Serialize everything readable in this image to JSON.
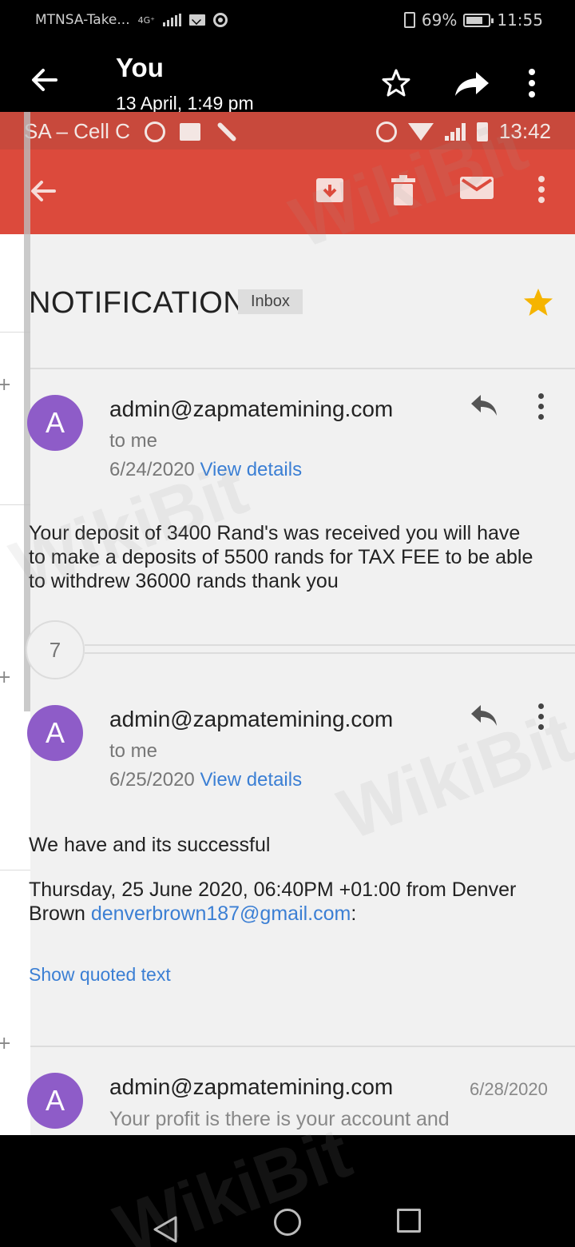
{
  "os_status": {
    "carrier": "MTNSA-Take...",
    "network": "4G⁺",
    "battery": "69%",
    "time": "11:55"
  },
  "viewer": {
    "title": "You",
    "subtitle": "13 April, 1:49 pm"
  },
  "inner_status": {
    "carrier": "SA – Cell C",
    "time": "13:42"
  },
  "email": {
    "subject": "NOTIFICATION",
    "label": "Inbox",
    "messages": [
      {
        "avatar": "A",
        "sender": "admin@zapmatemining.com",
        "to": "to me",
        "date": "6/24/2020",
        "details_link": "View details",
        "body": [
          "Your deposit of 3400 Rand's was received you will have",
          "to make a deposits of 5500 rands for TAX FEE to be able",
          "to withdrew 36000 rands thank you"
        ]
      },
      {
        "avatar": "A",
        "sender": "admin@zapmatemining.com",
        "to": "to me",
        "date": "6/25/2020",
        "details_link": "View details",
        "body_line1": "We have and its successful",
        "quote_line1": "Thursday, 25 June 2020, 06:40PM +01:00 from Denver",
        "quote_line2_prefix": "Brown ",
        "quote_email": "denverbrown187@gmail.com",
        "quote_suffix": ":",
        "show_quoted": "Show quoted text"
      },
      {
        "avatar": "A",
        "sender": "admin@zapmatemining.com",
        "date": "6/28/2020",
        "snippet": "Your profit is there is your account and"
      }
    ],
    "collapsed_count": "7"
  },
  "watermark": "WikiBit",
  "colors": {
    "toolbar": "#dc4a3c",
    "avatar": "#8e5cc8",
    "link": "#3b7fd4",
    "star": "#f5b400"
  }
}
